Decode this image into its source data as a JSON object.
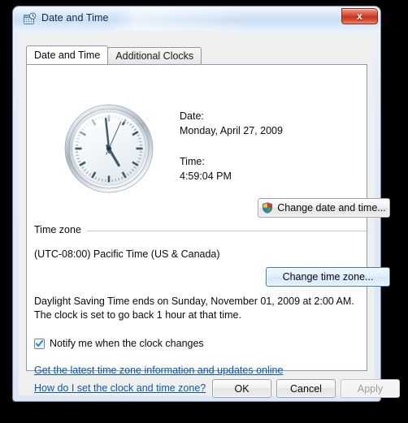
{
  "window": {
    "title": "Date and Time",
    "icon": "date-time-calendar-clock-icon",
    "close_label": "x"
  },
  "tabs": [
    {
      "label": "Date and Time",
      "active": true
    },
    {
      "label": "Additional Clocks",
      "active": false
    }
  ],
  "clock": {
    "name": "analog-clock",
    "hour": 4,
    "minute": 59,
    "second": 4,
    "hour_angle": 149.5,
    "minute_angle": 354,
    "second_angle": 24
  },
  "datetime": {
    "date_label": "Date:",
    "date_value": "Monday, April 27, 2009",
    "time_label": "Time:",
    "time_value": "4:59:04 PM",
    "change_button": "Change date and time...",
    "change_button_icon": "uac-shield-icon"
  },
  "timezone": {
    "group_label": "Time zone",
    "value": "(UTC-08:00) Pacific Time (US & Canada)",
    "change_button": "Change time zone..."
  },
  "dst": {
    "text": "Daylight Saving Time ends on Sunday, November 01, 2009 at 2:00 AM. The clock is set to go back 1 hour at that time.",
    "notify_label": "Notify me when the clock changes",
    "notify_checked": true
  },
  "links": [
    {
      "label": "Get the latest time zone information and updates online"
    },
    {
      "label": "How do I set the clock and time zone?"
    }
  ],
  "footer": {
    "ok": "OK",
    "cancel": "Cancel",
    "apply": "Apply",
    "apply_disabled": true
  },
  "colors": {
    "titlebar_blue": "#cfe2f5",
    "close_red": "#cf4026",
    "link_blue": "#0a58b4",
    "focus_blue": "#3c7fb1",
    "dialog_bg": "#f0f0f0",
    "page_bg": "#ffffff"
  }
}
